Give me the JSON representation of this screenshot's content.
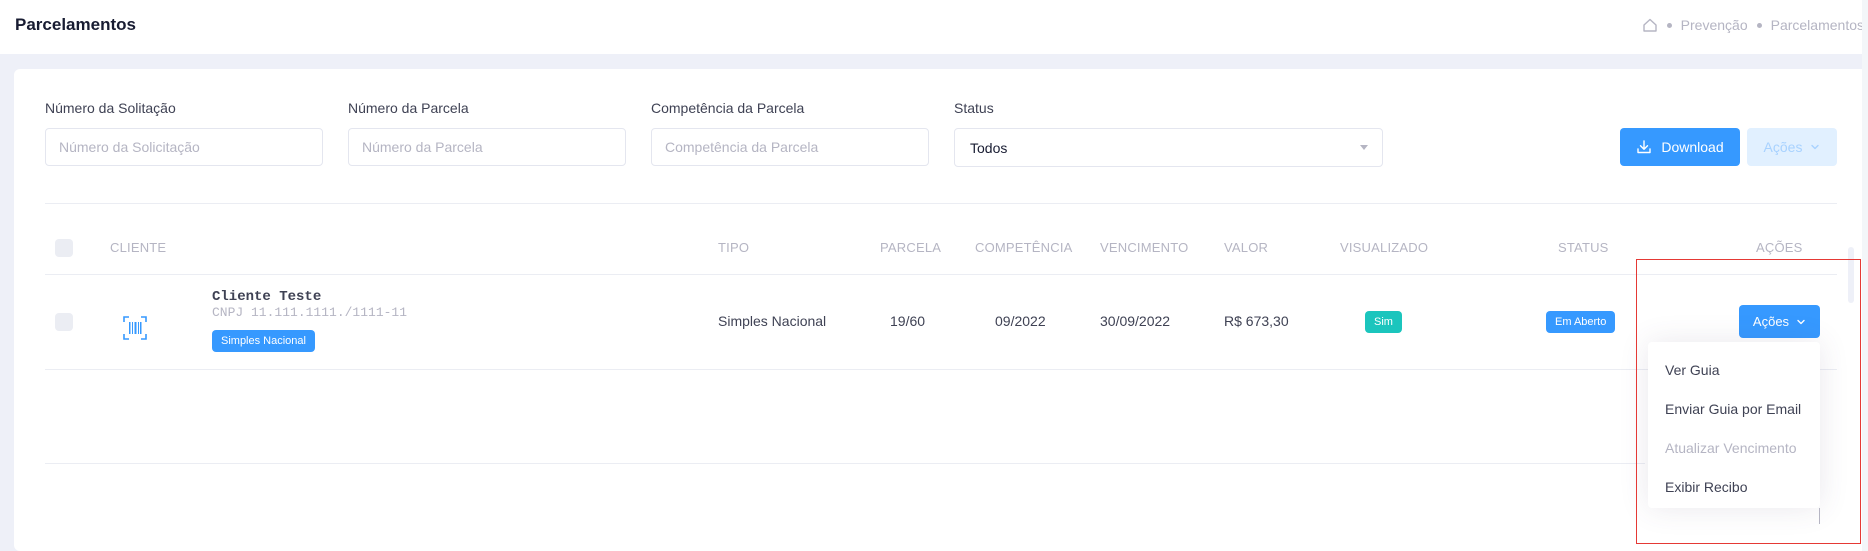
{
  "header": {
    "title": "Parcelamentos",
    "breadcrumb": [
      "Prevenção",
      "Parcelamentos"
    ]
  },
  "filters": {
    "solicitacao": {
      "label": "Número da Solitação",
      "placeholder": "Número da Solicitação",
      "value": ""
    },
    "parcela": {
      "label": "Número da Parcela",
      "placeholder": "Número da Parcela",
      "value": ""
    },
    "competencia": {
      "label": "Competência da Parcela",
      "placeholder": "Competência da Parcela",
      "value": ""
    },
    "status": {
      "label": "Status",
      "selected": "Todos"
    }
  },
  "toolbar": {
    "download_label": "Download",
    "acoes_label": "Ações"
  },
  "table": {
    "headers": {
      "cliente": "CLIENTE",
      "tipo": "TIPO",
      "parcela": "PARCELA",
      "competencia": "COMPETÊNCIA",
      "vencimento": "VENCIMENTO",
      "valor": "VALOR",
      "visualizado": "VISUALIZADO",
      "status": "STATUS",
      "acoes": "AÇÕES"
    },
    "rows": [
      {
        "client_name": "Cliente Teste",
        "cnpj": "CNPJ 11.111.1111./1111-11",
        "client_badge": "Simples Nacional",
        "tipo": "Simples Nacional",
        "parcela": "19/60",
        "competencia": "09/2022",
        "vencimento": "30/09/2022",
        "valor": "R$ 673,30",
        "visualizado": "Sim",
        "status": "Em Aberto",
        "acoes_label": "Ações"
      }
    ]
  },
  "dropdown": {
    "items": [
      {
        "label": "Ver Guia",
        "disabled": false
      },
      {
        "label": "Enviar Guia por Email",
        "disabled": false
      },
      {
        "label": "Atualizar Vencimento",
        "disabled": true
      },
      {
        "label": "Exibir Recibo",
        "disabled": false
      }
    ]
  },
  "colors": {
    "primary": "#3699ff",
    "success": "#1bc5bd",
    "highlight": "#e53935"
  }
}
